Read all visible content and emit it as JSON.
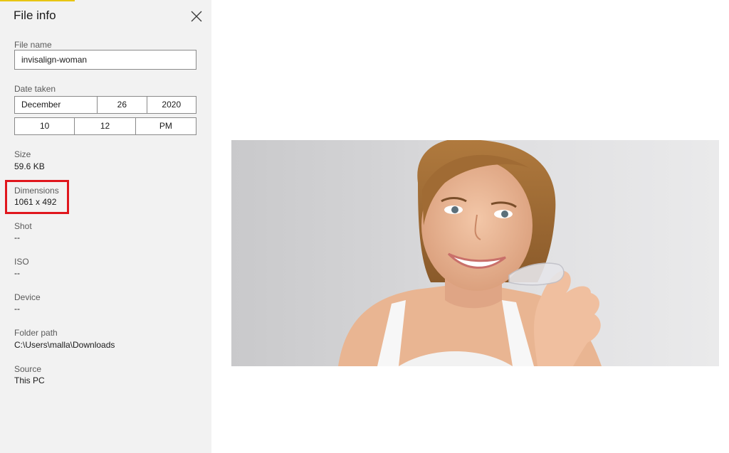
{
  "panel": {
    "title": "File info",
    "file_name": {
      "label": "File name",
      "value": "invisalign-woman"
    },
    "date_taken": {
      "label": "Date taken",
      "month": "December",
      "day": "26",
      "year": "2020",
      "hour": "10",
      "minute": "12",
      "period": "PM"
    },
    "size": {
      "label": "Size",
      "value": "59.6 KB"
    },
    "dimensions": {
      "label": "Dimensions",
      "value": "1061 x 492"
    },
    "shot": {
      "label": "Shot",
      "value": "--"
    },
    "iso": {
      "label": "ISO",
      "value": "--"
    },
    "device": {
      "label": "Device",
      "value": "--"
    },
    "folder_path": {
      "label": "Folder path",
      "value": "C:\\Users\\malla\\Downloads"
    },
    "source": {
      "label": "Source",
      "value": "This PC"
    }
  },
  "icons": {
    "close": "close-icon"
  },
  "colors": {
    "panel_background": "#f2f2f2",
    "accent": "#e8c513",
    "highlight": "#e0161d"
  }
}
